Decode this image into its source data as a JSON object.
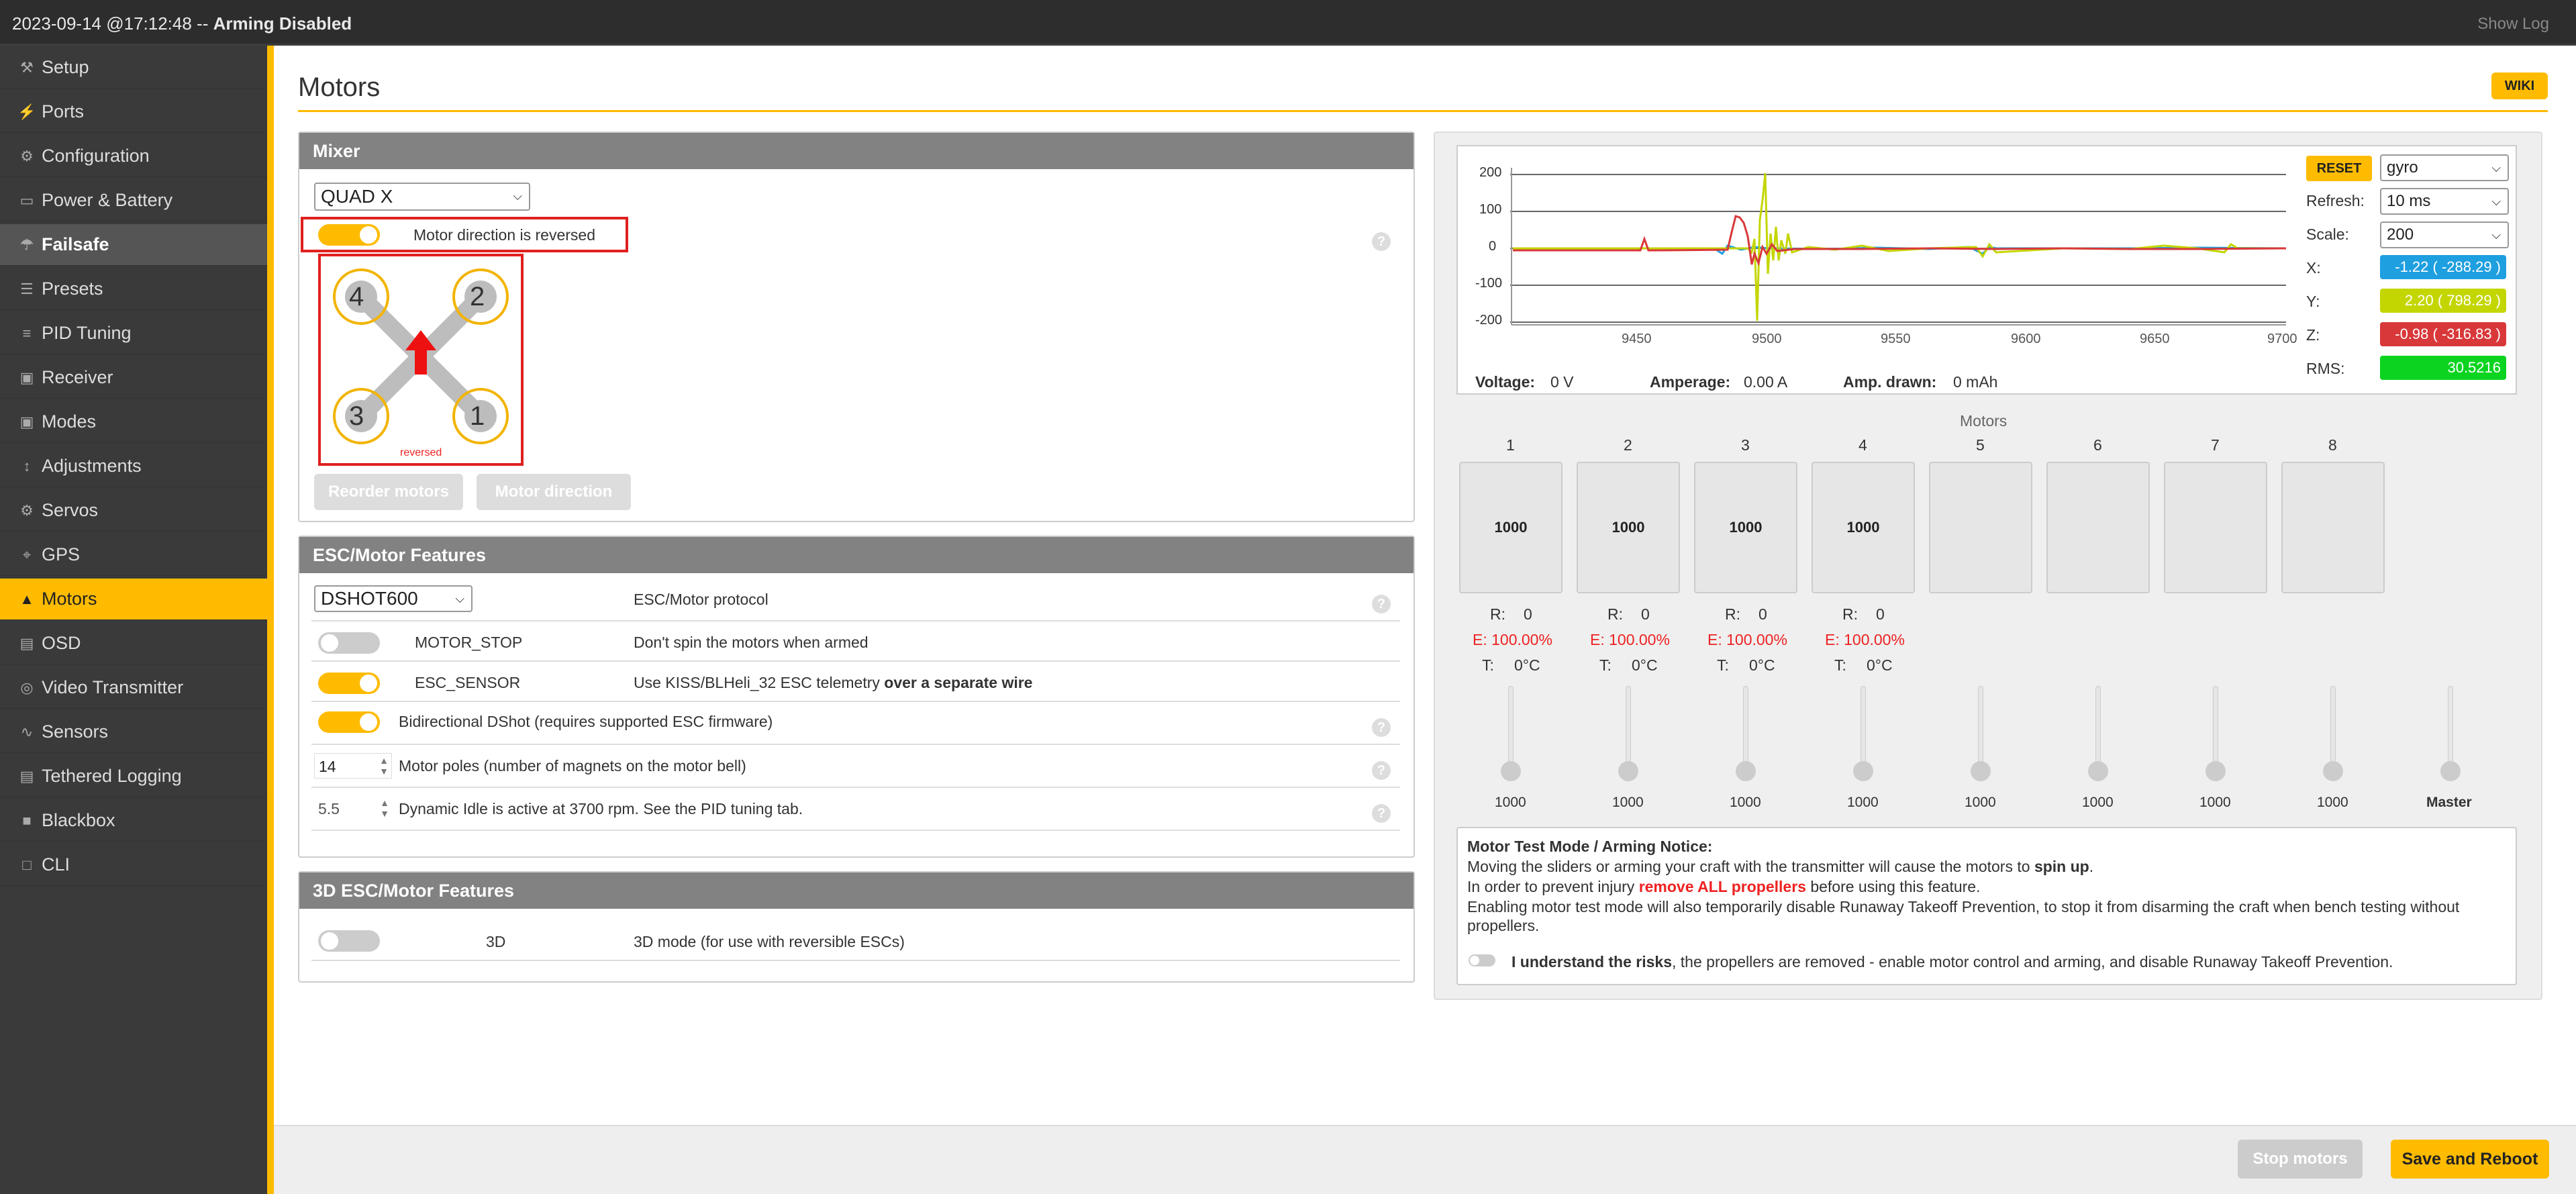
{
  "status_bar": {
    "datetime": "2023-09-14 @17:12:48",
    "separator": " -- ",
    "state": "Arming Disabled",
    "show_log": "Show Log"
  },
  "nav": [
    {
      "label": "Setup",
      "icon": "wrench-icon",
      "glyph": "⚒"
    },
    {
      "label": "Ports",
      "icon": "plug-icon",
      "glyph": "⚡"
    },
    {
      "label": "Configuration",
      "icon": "gear-icon",
      "glyph": "⚙"
    },
    {
      "label": "Power & Battery",
      "icon": "battery-icon",
      "glyph": "▭"
    },
    {
      "label": "Failsafe",
      "icon": "parachute-icon",
      "glyph": "☂"
    },
    {
      "label": "Presets",
      "icon": "presets-icon",
      "glyph": "☰"
    },
    {
      "label": "PID Tuning",
      "icon": "sliders-icon",
      "glyph": "≡"
    },
    {
      "label": "Receiver",
      "icon": "receiver-icon",
      "glyph": "▣"
    },
    {
      "label": "Modes",
      "icon": "modes-icon",
      "glyph": "▣"
    },
    {
      "label": "Adjustments",
      "icon": "adjustments-icon",
      "glyph": "↕"
    },
    {
      "label": "Servos",
      "icon": "servo-icon",
      "glyph": "⚙"
    },
    {
      "label": "GPS",
      "icon": "gps-icon",
      "glyph": "⌖"
    },
    {
      "label": "Motors",
      "icon": "motor-icon",
      "glyph": "▲"
    },
    {
      "label": "OSD",
      "icon": "osd-icon",
      "glyph": "▤"
    },
    {
      "label": "Video Transmitter",
      "icon": "antenna-icon",
      "glyph": "◎"
    },
    {
      "label": "Sensors",
      "icon": "sensors-icon",
      "glyph": "∿"
    },
    {
      "label": "Tethered Logging",
      "icon": "logging-icon",
      "glyph": "▤"
    },
    {
      "label": "Blackbox",
      "icon": "blackbox-icon",
      "glyph": "■"
    },
    {
      "label": "CLI",
      "icon": "terminal-icon",
      "glyph": "□"
    }
  ],
  "page": {
    "title": "Motors",
    "wiki": "WIKI"
  },
  "mixer": {
    "header": "Mixer",
    "type": "QUAD X",
    "reversed_label": "Motor direction is reversed",
    "reversed_caption": "reversed",
    "motor_numbers": [
      "4",
      "2",
      "3",
      "1"
    ],
    "reorder_button": "Reorder motors",
    "direction_button": "Motor direction"
  },
  "esc": {
    "header": "ESC/Motor Features",
    "protocol": "DSHOT600",
    "protocol_label": "ESC/Motor protocol",
    "motor_stop": "MOTOR_STOP",
    "motor_stop_desc": "Don't spin the motors when armed",
    "esc_sensor": "ESC_SENSOR",
    "esc_sensor_desc": "Use KISS/BLHeli_32 ESC telemetry ",
    "esc_sensor_desc_bold": "over a separate wire",
    "bidir": "Bidirectional DShot (requires supported ESC firmware)",
    "poles_value": "14",
    "poles_label": "Motor poles (number of magnets on the motor bell)",
    "idle_value": "5.5",
    "idle_label": "Dynamic Idle is active at 3700 rpm. See the PID tuning tab."
  },
  "esc3d": {
    "header": "3D ESC/Motor Features",
    "name": "3D",
    "desc": "3D mode (for use with reversible ESCs)"
  },
  "graph": {
    "reset": "RESET",
    "sensor": "gyro",
    "refresh_label": "Refresh:",
    "refresh": "10 ms",
    "scale_label": "Scale:",
    "scale": "200",
    "x_label": "X:",
    "x_value": "-1.22 ( -288.29 )",
    "y_label": "Y:",
    "y_value": "2.20 ( 798.29 )",
    "z_label": "Z:",
    "z_value": "-0.98 ( -316.83 )",
    "rms_label": "RMS:",
    "rms_value": "30.5216",
    "y_ticks": [
      "200",
      "100",
      "0",
      "-100",
      "-200"
    ],
    "x_ticks": [
      "9450",
      "9500",
      "9550",
      "9600",
      "9650",
      "9700"
    ],
    "voltage_label": "Voltage:",
    "voltage": "0 V",
    "amperage_label": "Amperage:",
    "amperage": "0.00 A",
    "drawn_label": "Amp. drawn:",
    "drawn": "0 mAh",
    "colors": {
      "x": "#1e9fe0",
      "y": "#c4d600",
      "z": "#d9383a"
    }
  },
  "motors": {
    "title": "Motors",
    "numbers": [
      "1",
      "2",
      "3",
      "4",
      "5",
      "6",
      "7",
      "8"
    ],
    "values": [
      "1000",
      "1000",
      "1000",
      "1000",
      "",
      "",
      "",
      ""
    ],
    "rpm_label": "R:",
    "rpm": [
      "0",
      "0",
      "0",
      "0"
    ],
    "err": [
      "E: 100.00%",
      "E: 100.00%",
      "E: 100.00%",
      "E: 100.00%"
    ],
    "temp_label": "T:",
    "temp": [
      "0°C",
      "0°C",
      "0°C",
      "0°C"
    ],
    "slider_values": [
      "1000",
      "1000",
      "1000",
      "1000",
      "1000",
      "1000",
      "1000",
      "1000"
    ],
    "master": "Master"
  },
  "notice": {
    "title": "Motor Test Mode / Arming Notice:",
    "line1a": "Moving the sliders or arming your craft with the transmitter will cause the motors to ",
    "line1b": "spin up",
    "line1c": ".",
    "line2a": "In order to prevent injury ",
    "line2b": "remove ALL propellers",
    "line2c": " before using this feature.",
    "line3": "Enabling motor test mode will also temporarily disable Runaway Takeoff Prevention, to stop it from disarming the craft when bench testing without",
    "line4": "propellers.",
    "ack_bold": "I understand the risks",
    "ack_rest": ", the propellers are removed - enable motor control and arming, and disable Runaway Takeoff Prevention."
  },
  "footer": {
    "stop": "Stop motors",
    "save": "Save and Reboot"
  }
}
